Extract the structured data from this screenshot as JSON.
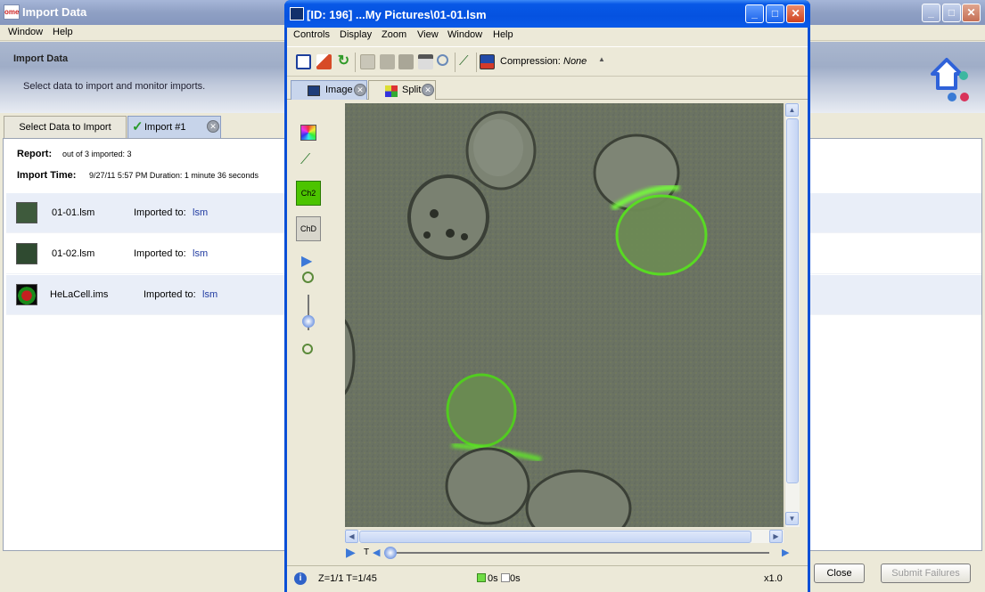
{
  "import_window": {
    "title": "Import Data",
    "logo_text": "ome",
    "menu": [
      "Window",
      "Help"
    ],
    "banner_title": "Import Data",
    "banner_desc": "Select data to import and monitor imports.",
    "tabs": [
      {
        "label": "Select Data to Import"
      },
      {
        "label": "Import #1",
        "close": "✕"
      }
    ],
    "report_label": "Report:",
    "report_value": "out of 3 imported: 3",
    "import_time_label": "Import Time:",
    "import_time_value": "9/27/11 5:57 PM Duration:  1 minute 36 seconds",
    "files": [
      {
        "name": "01-01.lsm",
        "imported_to_label": "Imported to:",
        "target": "lsm"
      },
      {
        "name": "01-02.lsm",
        "imported_to_label": "Imported to:",
        "target": "lsm"
      },
      {
        "name": "HeLaCell.ims",
        "imported_to_label": "Imported to:",
        "target": "lsm"
      }
    ],
    "close_button": "Close",
    "submit_failures_button": "Submit Failures"
  },
  "viewer": {
    "title": "[ID: 196] ...My Pictures\\01-01.lsm",
    "menu": [
      "Controls",
      "Display",
      "Zoom",
      "View",
      "Window",
      "Help"
    ],
    "compression_label": "Compression:",
    "compression_value": "None",
    "tabs": [
      {
        "label": "Image",
        "close": "✕"
      },
      {
        "label": "Split",
        "close": "✕"
      }
    ],
    "channel_buttons": [
      "Ch2",
      "ChD"
    ],
    "timeline_label": "T",
    "status": {
      "zt": "Z=1/1 T=1/45",
      "time_a": "0s",
      "time_b": "0s",
      "zoom": "x1.0"
    },
    "colors": {
      "title_bar": "#0552e0",
      "channel_green": "#4cc400",
      "overlay": "#5fae35"
    }
  }
}
